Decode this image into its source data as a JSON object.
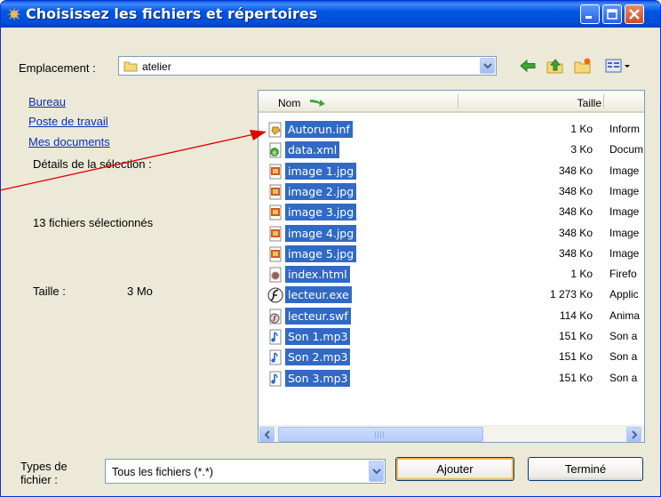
{
  "window": {
    "title": "Choisissez les fichiers et répertoires"
  },
  "location": {
    "label": "Emplacement :",
    "value": "atelier"
  },
  "sidebar": {
    "links": [
      "Bureau",
      "Poste de travail",
      "Mes documents"
    ],
    "details_label": "Détails de la sélection :",
    "selection_count": "13 fichiers sélectionnés",
    "size_label": "Taille :",
    "size_value": "3 Mo"
  },
  "file_list": {
    "columns": {
      "name": "Nom",
      "size": "Taille"
    },
    "files": [
      {
        "name": "Autorun.inf",
        "size": "1 Ko",
        "type": "Inform",
        "icon": "inf-icon"
      },
      {
        "name": "data.xml",
        "size": "3 Ko",
        "type": "Docum",
        "icon": "xml-icon"
      },
      {
        "name": "image 1.jpg",
        "size": "348 Ko",
        "type": "Image",
        "icon": "jpg-icon"
      },
      {
        "name": "image 2.jpg",
        "size": "348 Ko",
        "type": "Image",
        "icon": "jpg-icon"
      },
      {
        "name": "image 3.jpg",
        "size": "348 Ko",
        "type": "Image",
        "icon": "jpg-icon"
      },
      {
        "name": "image 4.jpg",
        "size": "348 Ko",
        "type": "Image",
        "icon": "jpg-icon"
      },
      {
        "name": "image 5.jpg",
        "size": "348 Ko",
        "type": "Image",
        "icon": "jpg-icon"
      },
      {
        "name": "index.html",
        "size": "1 Ko",
        "type": "Firefo",
        "icon": "html-icon"
      },
      {
        "name": "lecteur.exe",
        "size": "1 273 Ko",
        "type": "Applic",
        "icon": "exe-icon"
      },
      {
        "name": "lecteur.swf",
        "size": "114 Ko",
        "type": "Anima",
        "icon": "swf-icon"
      },
      {
        "name": "Son 1.mp3",
        "size": "151 Ko",
        "type": "Son a",
        "icon": "mp3-icon"
      },
      {
        "name": "Son 2.mp3",
        "size": "151 Ko",
        "type": "Son a",
        "icon": "mp3-icon"
      },
      {
        "name": "Son 3.mp3",
        "size": "151 Ko",
        "type": "Son a",
        "icon": "mp3-icon"
      }
    ]
  },
  "footer": {
    "types_label_line1": "Types de",
    "types_label_line2": "fichier :",
    "file_type": "Tous les fichiers (*.*)",
    "add_button": "Ajouter",
    "done_button": "Terminé"
  },
  "colors": {
    "selection": "#316ac5",
    "title_bar": "#0054e3",
    "annotation_arrow": "#e00000"
  }
}
